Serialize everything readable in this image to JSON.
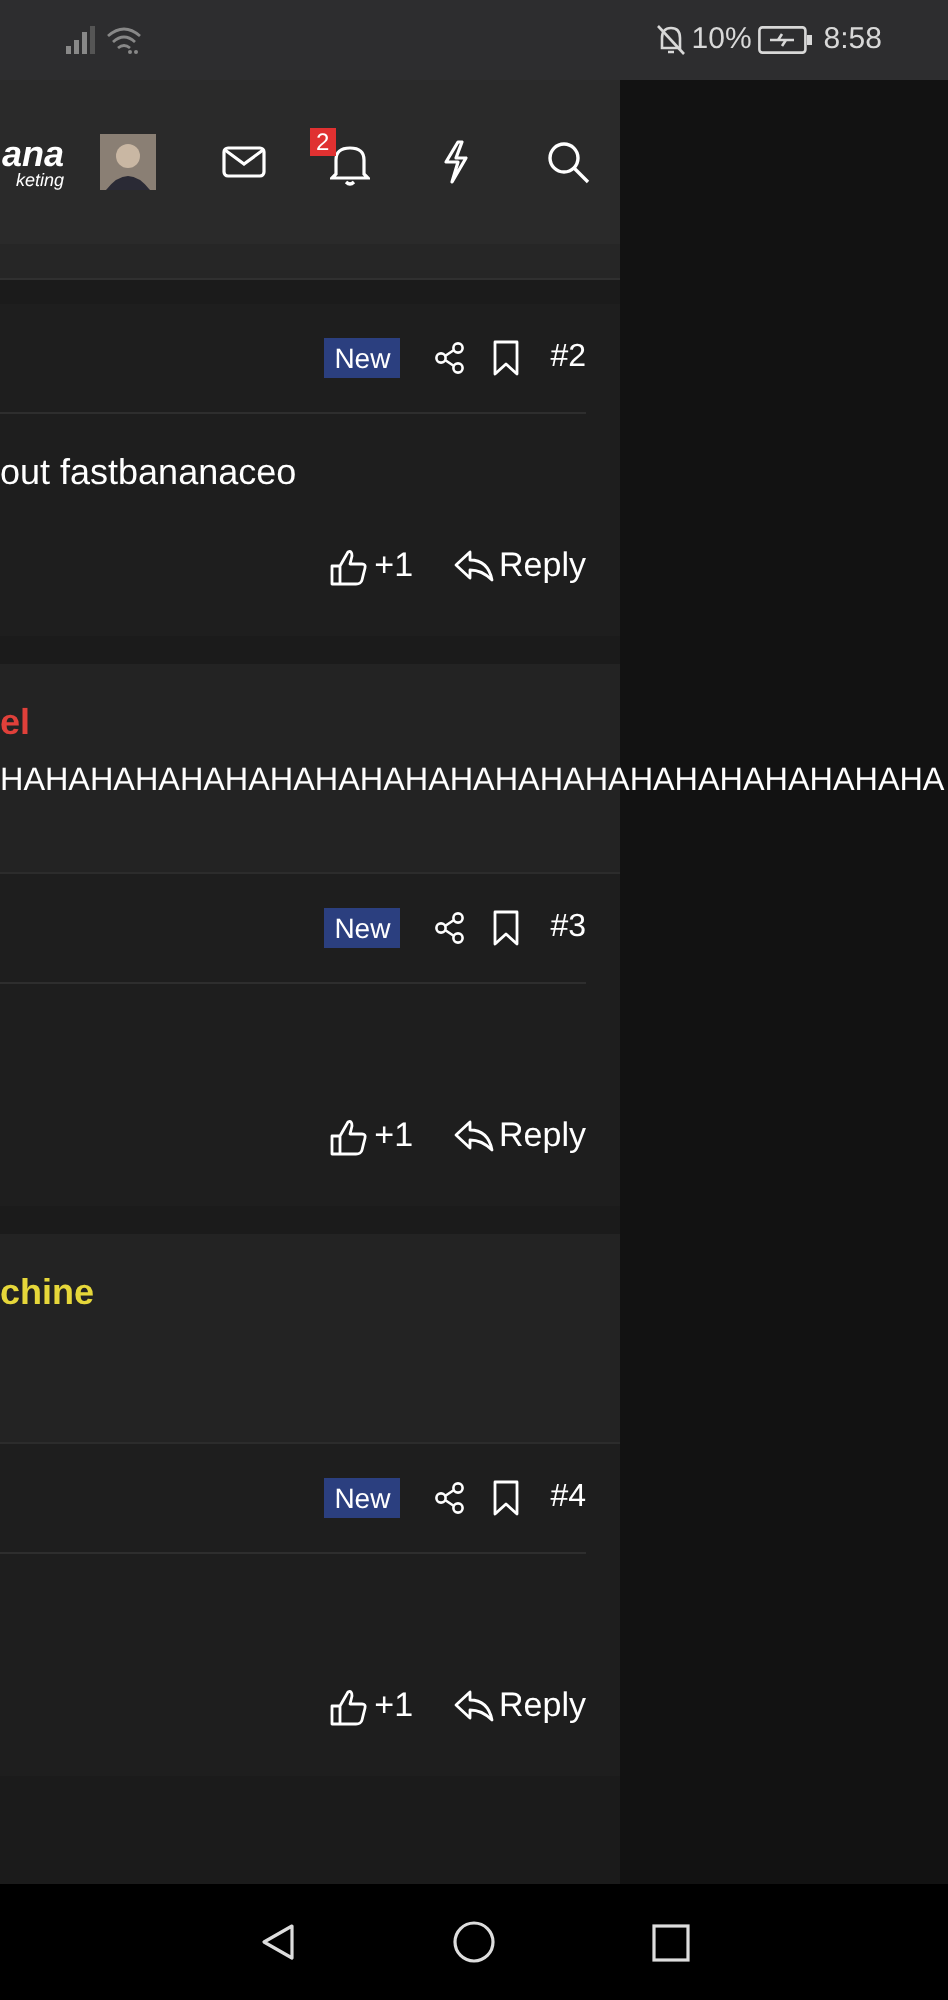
{
  "status_bar": {
    "battery": "10%",
    "time": "8:58"
  },
  "header": {
    "logo": [
      "ana",
      "keting"
    ],
    "notification_count": "2"
  },
  "posts": [
    {
      "kind": "message",
      "badge": "New",
      "number": "#2",
      "body": "out fastbananaceo",
      "likes": "+1",
      "reply": "Reply"
    },
    {
      "kind": "user",
      "name": "el",
      "color": "#e0403a",
      "title": "HAHAHAHAHAHAHAHAHAHAHAHAHAHAHAHAHAHAHAHAHA"
    },
    {
      "kind": "message",
      "badge": "New",
      "number": "#3",
      "likes": "+1",
      "reply": "Reply"
    },
    {
      "kind": "user",
      "name": "chine",
      "color": "#e6d73a"
    },
    {
      "kind": "message",
      "badge": "New",
      "number": "#4",
      "likes": "+1",
      "reply": "Reply"
    }
  ]
}
